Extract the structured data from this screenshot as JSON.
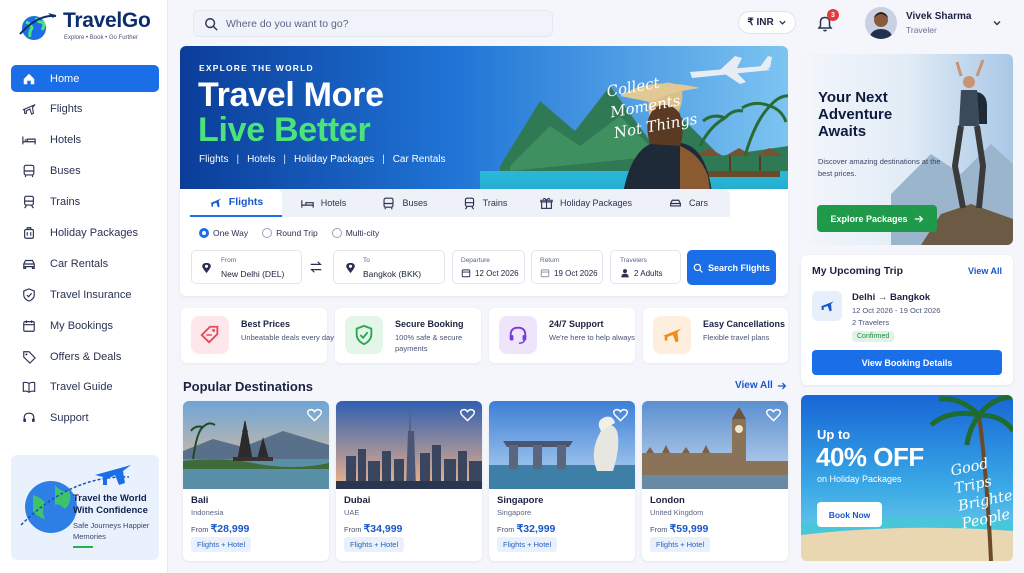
{
  "brand": {
    "name": "TravelGo",
    "tagline": "Explore • Book • Go Further"
  },
  "header": {
    "search_placeholder": "Where do you want to go?",
    "currency": "₹ INR",
    "notification_count": "3",
    "user": {
      "name": "Vivek Sharma",
      "role": "Traveler"
    }
  },
  "sidebar": {
    "items": [
      {
        "label": "Home",
        "icon": "home-icon",
        "active": true
      },
      {
        "label": "Flights",
        "icon": "plane-icon"
      },
      {
        "label": "Hotels",
        "icon": "bed-icon"
      },
      {
        "label": "Buses",
        "icon": "bus-icon"
      },
      {
        "label": "Trains",
        "icon": "train-icon"
      },
      {
        "label": "Holiday Packages",
        "icon": "suitcase-icon"
      },
      {
        "label": "Car Rentals",
        "icon": "car-icon"
      },
      {
        "label": "Travel Insurance",
        "icon": "shield-icon"
      },
      {
        "label": "My Bookings",
        "icon": "calendar-icon"
      },
      {
        "label": "Offers & Deals",
        "icon": "tag-icon"
      },
      {
        "label": "Travel Guide",
        "icon": "book-icon"
      },
      {
        "label": "Support",
        "icon": "headset-icon"
      }
    ],
    "promo": {
      "title": "Travel the World With Confidence",
      "subtitle": "Safe Journeys Happier Memories"
    }
  },
  "hero": {
    "kicker": "EXPLORE THE WORLD",
    "title_line1": "Travel More",
    "title_line2": "Live Better",
    "links": [
      "Flights",
      "Hotels",
      "Holiday Packages",
      "Car Rentals"
    ],
    "script_lines": [
      "Collect",
      "Moments",
      "Not Things"
    ]
  },
  "search_panel": {
    "tabs": [
      {
        "label": "Flights",
        "icon": "plane-icon",
        "active": true
      },
      {
        "label": "Hotels",
        "icon": "bed-icon"
      },
      {
        "label": "Buses",
        "icon": "bus-icon"
      },
      {
        "label": "Trains",
        "icon": "train-icon"
      },
      {
        "label": "Holiday Packages",
        "icon": "gift-icon"
      },
      {
        "label": "Cars",
        "icon": "car-icon"
      }
    ],
    "trip_types": [
      {
        "label": "One Way",
        "selected": true
      },
      {
        "label": "Round Trip",
        "selected": false
      },
      {
        "label": "Multi-city",
        "selected": false
      }
    ],
    "from": {
      "label": "From",
      "value": "New Delhi (DEL)"
    },
    "to": {
      "label": "To",
      "value": "Bangkok (BKK)"
    },
    "departure": {
      "label": "Departure",
      "value": "12 Oct 2026"
    },
    "return": {
      "label": "Return",
      "value": "19 Oct 2026"
    },
    "travelers": {
      "label": "Travelers",
      "value": "2 Adults"
    },
    "search_button": "Search Flights"
  },
  "features": [
    {
      "title": "Best Prices",
      "subtitle": "Unbeatable deals every day",
      "icon": "price-tag-icon",
      "color": "#e8475d"
    },
    {
      "title": "Secure Booking",
      "subtitle": "100% safe & secure payments",
      "icon": "shield-check-icon",
      "color": "#2aa552"
    },
    {
      "title": "24/7 Support",
      "subtitle": "We're here to help always",
      "icon": "headset-icon",
      "color": "#7a3ad6"
    },
    {
      "title": "Easy Cancellations",
      "subtitle": "Flexible travel plans",
      "icon": "plane-icon",
      "color": "#f08c1e"
    }
  ],
  "destinations": {
    "title": "Popular Destinations",
    "view_all": "View All",
    "items": [
      {
        "name": "Bali",
        "country": "Indonesia",
        "price_prefix": "From",
        "price": "₹28,999",
        "tag": "Flights + Hotel"
      },
      {
        "name": "Dubai",
        "country": "UAE",
        "price_prefix": "From",
        "price": "₹34,999",
        "tag": "Flights + Hotel"
      },
      {
        "name": "Singapore",
        "country": "Singapore",
        "price_prefix": "From",
        "price": "₹32,999",
        "tag": "Flights + Hotel"
      },
      {
        "name": "London",
        "country": "United Kingdom",
        "price_prefix": "From",
        "price": "₹59,999",
        "tag": "Flights + Hotel"
      }
    ]
  },
  "adventure": {
    "title": "Your Next Adventure Awaits",
    "subtitle": "Discover amazing destinations at the best prices.",
    "button": "Explore Packages"
  },
  "upcoming_trip": {
    "title": "My Upcoming Trip",
    "view_all": "View All",
    "from": "Delhi",
    "to": "Bangkok",
    "dates": "12 Oct 2026 - 19 Oct 2026",
    "travelers": "2 Travelers",
    "status": "Confirmed",
    "button": "View Booking Details"
  },
  "offer": {
    "line1": "Up to",
    "line2": "40% OFF",
    "line3": "on Holiday Packages",
    "button": "Book Now",
    "script_lines": [
      "Good",
      "Trips",
      "Brighter",
      "People"
    ]
  },
  "colors": {
    "primary": "#1a6ee8",
    "green": "#2ecc71",
    "navy": "#0c2e6e"
  }
}
